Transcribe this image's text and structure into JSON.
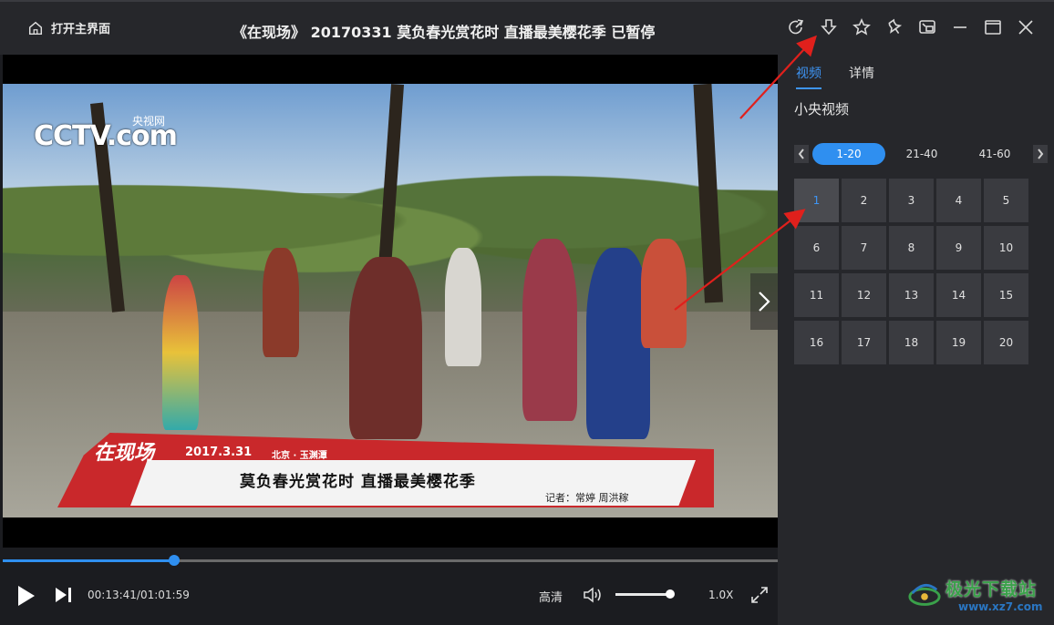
{
  "titlebar": {
    "home_label": "打开主界面",
    "title": "《在现场》 20170331 莫负春光赏花时 直播最美樱花季 已暂停",
    "icons": [
      "share-icon",
      "download-icon",
      "favorite-icon",
      "pin-icon",
      "mini-window-icon",
      "minimize-icon",
      "maximize-icon",
      "close-icon"
    ]
  },
  "video": {
    "logo_text": "CCTV.com",
    "logo_sub": "央视网",
    "overlay": {
      "program_logo": "在现场",
      "date": "2017.3.31",
      "location": "北京 · 玉渊潭",
      "headline": "莫负春光赏花时 直播最美樱花季",
      "reporter": "记者：常婷 周洪稼"
    }
  },
  "controls": {
    "current_time": "00:13:41",
    "duration": "01:01:59",
    "time_display": "00:13:41/01:01:59",
    "progress_fraction": 0.221,
    "quality": "高清",
    "volume_fraction": 0.93,
    "speed": "1.0X"
  },
  "sidebar": {
    "tabs": [
      {
        "label": "视频",
        "active": true
      },
      {
        "label": "详情",
        "active": false
      }
    ],
    "channel": "小央视频",
    "ranges": [
      {
        "label": "1-20",
        "active": true
      },
      {
        "label": "21-40",
        "active": false
      },
      {
        "label": "41-60",
        "active": false
      }
    ],
    "episodes": [
      "1",
      "2",
      "3",
      "4",
      "5",
      "6",
      "7",
      "8",
      "9",
      "10",
      "11",
      "12",
      "13",
      "14",
      "15",
      "16",
      "17",
      "18",
      "19",
      "20"
    ],
    "active_episode": "1"
  },
  "watermark": {
    "name": "极光下载站",
    "url": "www.xz7.com"
  },
  "colors": {
    "accent": "#2f8ff0",
    "annotation_arrow": "#e0201c",
    "sidebar_bg": "#26272b"
  }
}
